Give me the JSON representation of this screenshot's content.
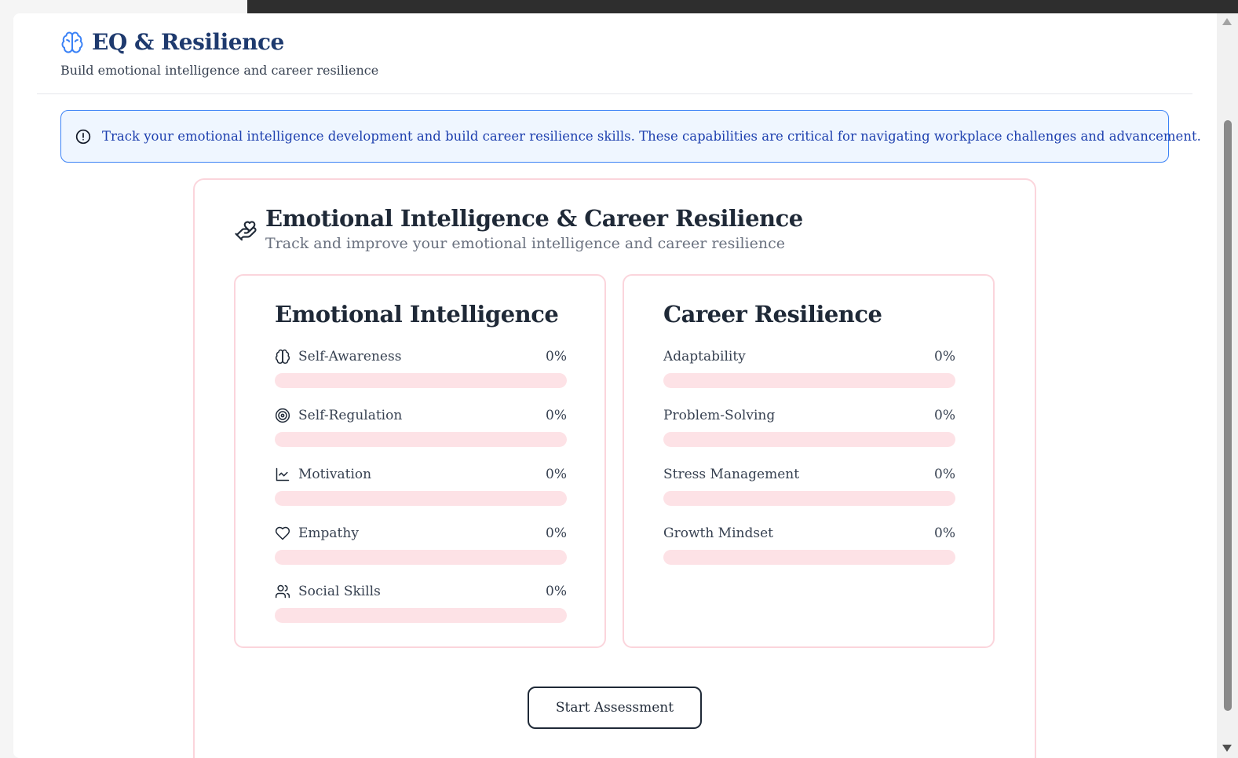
{
  "header": {
    "icon": "brain-icon",
    "title": "EQ & Resilience",
    "subtitle": "Build emotional intelligence and career resilience"
  },
  "info_banner": {
    "icon": "alert-circle-icon",
    "text": "Track your emotional intelligence development and build career resilience skills. These capabilities are critical for navigating workplace challenges and advancement."
  },
  "main_card": {
    "icon": "hand-heart-icon",
    "title": "Emotional Intelligence & Career Resilience",
    "subtitle": "Track and improve your emotional intelligence and career resilience"
  },
  "emotional_intelligence": {
    "title": "Emotional Intelligence",
    "metrics": [
      {
        "label": "Self-Awareness",
        "value": "0%",
        "progress": 0,
        "icon": "brain-icon"
      },
      {
        "label": "Self-Regulation",
        "value": "0%",
        "progress": 0,
        "icon": "target-icon"
      },
      {
        "label": "Motivation",
        "value": "0%",
        "progress": 0,
        "icon": "line-chart-icon"
      },
      {
        "label": "Empathy",
        "value": "0%",
        "progress": 0,
        "icon": "heart-icon"
      },
      {
        "label": "Social Skills",
        "value": "0%",
        "progress": 0,
        "icon": "users-icon"
      }
    ]
  },
  "career_resilience": {
    "title": "Career Resilience",
    "metrics": [
      {
        "label": "Adaptability",
        "value": "0%",
        "progress": 0
      },
      {
        "label": "Problem-Solving",
        "value": "0%",
        "progress": 0
      },
      {
        "label": "Stress Management",
        "value": "0%",
        "progress": 0
      },
      {
        "label": "Growth Mindset",
        "value": "0%",
        "progress": 0
      }
    ]
  },
  "actions": {
    "start_label": "Start Assessment"
  },
  "colors": {
    "primary": "#1e3a6e",
    "accent_blue": "#3b82f6",
    "info_bg": "#eff6ff",
    "card_border": "#fbd5dc",
    "bar_track": "#fde2e6"
  }
}
